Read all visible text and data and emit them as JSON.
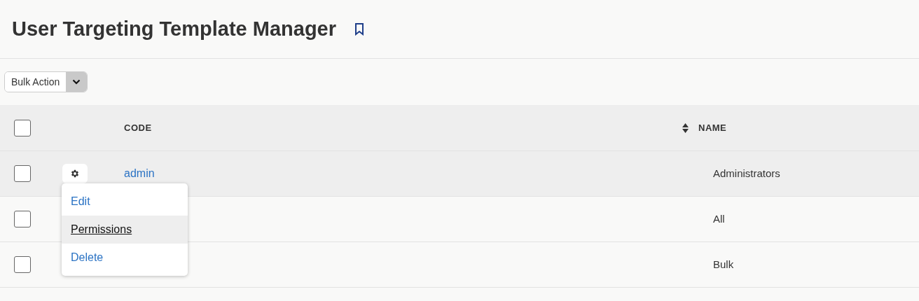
{
  "page": {
    "title": "User Targeting Template Manager"
  },
  "toolbar": {
    "bulk_action": {
      "label": "Bulk Action"
    }
  },
  "table": {
    "header_checkbox": {
      "checked": false
    },
    "columns": [
      {
        "label": "CODE",
        "sortable": true
      },
      {
        "label": "NAME",
        "sortable": false
      }
    ],
    "rows": [
      {
        "checked": false,
        "code": "admin",
        "name": "Administrators",
        "menu": [
          {
            "label": "Edit",
            "hovered": false
          },
          {
            "label": "Permissions",
            "hovered": true
          },
          {
            "label": "Delete",
            "hovered": false
          }
        ]
      },
      {
        "checked": false,
        "name": "All"
      },
      {
        "checked": false,
        "name": "Bulk"
      }
    ]
  }
}
